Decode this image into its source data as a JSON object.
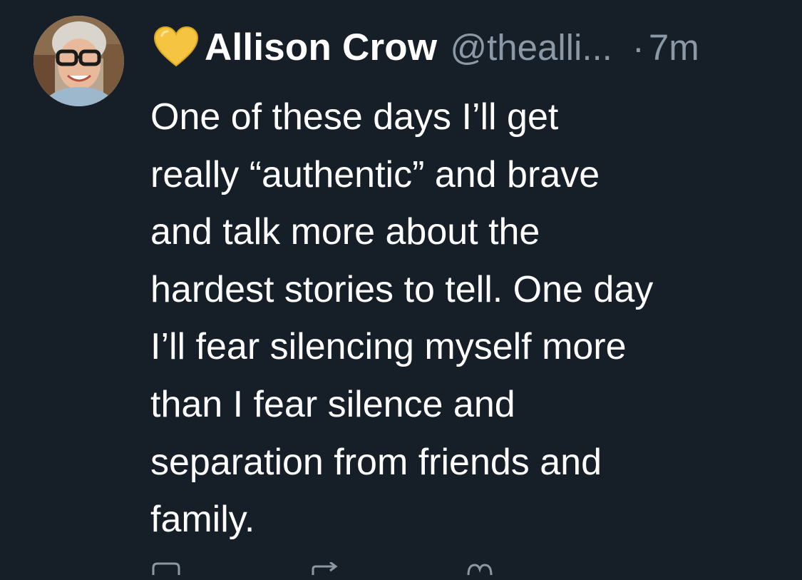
{
  "post": {
    "emoji": "💛",
    "display_name": "Allison Crow",
    "handle": "@thealli...",
    "separator": "·",
    "timestamp": "7m",
    "text": "One of these days I’ll get\nreally “authentic” and brave\nand talk more about the\nhardest stories to tell. One day\nI’ll fear silencing myself more\nthan I fear silence and\nseparation from friends and\nfamily."
  },
  "actions": [
    {
      "icon": "reply-icon"
    },
    {
      "icon": "repost-icon"
    },
    {
      "icon": "like-icon"
    }
  ],
  "colors": {
    "background": "#161e27",
    "text": "#ffffff",
    "muted": "#8b98a5",
    "heart": "#f5c542"
  }
}
